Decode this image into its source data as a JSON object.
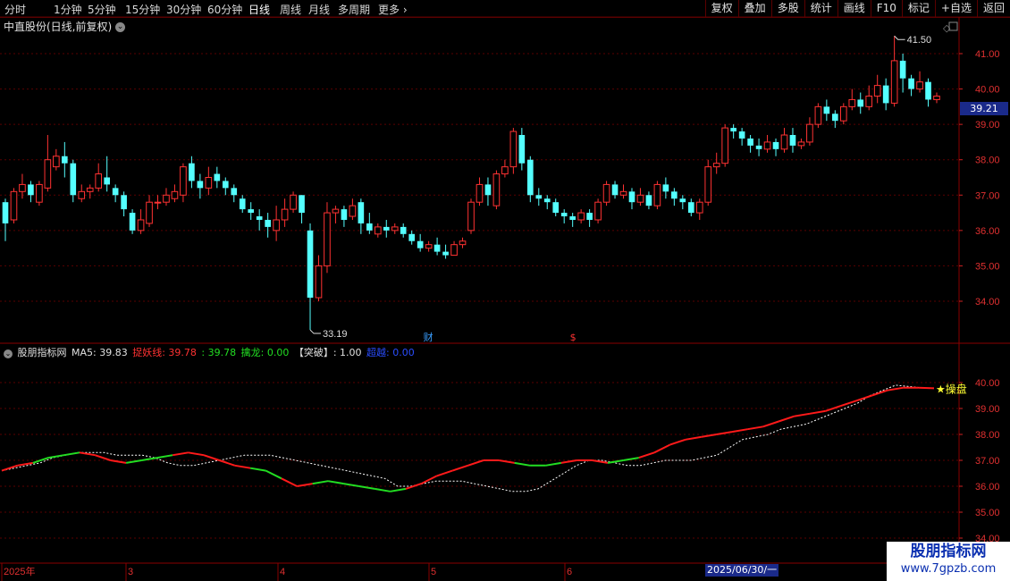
{
  "toolbar": {
    "timeframes": [
      "分时",
      "1分钟",
      "5分钟",
      "15分钟",
      "30分钟",
      "60分钟",
      "日线",
      "周线",
      "月线",
      "多周期",
      "更多"
    ],
    "active": "日线",
    "right_buttons": [
      "复权",
      "叠加",
      "多股",
      "统计",
      "画线",
      "F10",
      "标记",
      "+自选",
      "返回"
    ]
  },
  "stock": {
    "title": "中直股份(日线,前复权)",
    "current_price": "39.21",
    "high_label": "41.50",
    "low_label": "33.19",
    "event_cai": "财",
    "event_s": "$"
  },
  "price_axis": {
    "ticks": [
      "41.00",
      "40.00",
      "39.00",
      "38.00",
      "37.00",
      "36.00",
      "35.00",
      "34.00"
    ]
  },
  "indicator": {
    "name": "股朋指标网",
    "ma5_label": "MA5: 39.83",
    "zhuoyao_label": "捉妖线: 39.78",
    "zhuoyao_value": ": 39.78",
    "qinlong_label": "擒龙: 0.00",
    "tupo_label": "【突破】: 1.00",
    "chaoyue_label": "超越: 0.00",
    "marker_label": "★操盘",
    "ticks": [
      "40.00",
      "39.00",
      "38.00",
      "37.00",
      "36.00",
      "35.00",
      "34.00"
    ]
  },
  "time_axis": {
    "labels": [
      "2025年",
      "3",
      "4",
      "5",
      "6"
    ],
    "date_tag": "2025/06/30/一"
  },
  "watermark": {
    "line1": "股朋指标网",
    "line2": "www.7gpzb.com"
  },
  "colors": {
    "up": "#ff3232",
    "down": "#54ffff",
    "grid": "#5a0000",
    "bull_line": "#ff1a1a",
    "bear_line": "#22dd22",
    "ma_line": "#ffffff"
  },
  "chart_data": {
    "type": "candlestick",
    "candles": [
      [
        36.8,
        36.2,
        36.9,
        35.7
      ],
      [
        36.3,
        37.1,
        37.2,
        36.2
      ],
      [
        37.1,
        37.3,
        37.6,
        36.9
      ],
      [
        37.3,
        37.0,
        37.4,
        36.8
      ],
      [
        36.8,
        37.3,
        37.4,
        36.7
      ],
      [
        37.2,
        38.0,
        38.7,
        37.1
      ],
      [
        37.8,
        38.1,
        38.3,
        37.7
      ],
      [
        38.1,
        37.9,
        38.5,
        37.5
      ],
      [
        37.9,
        37.0,
        38.0,
        36.8
      ],
      [
        36.9,
        37.1,
        37.3,
        36.8
      ],
      [
        37.1,
        37.2,
        37.3,
        36.9
      ],
      [
        37.2,
        37.6,
        37.9,
        37.1
      ],
      [
        37.5,
        37.3,
        38.1,
        37.1
      ],
      [
        37.2,
        37.0,
        37.3,
        36.8
      ],
      [
        37.0,
        36.6,
        37.1,
        36.4
      ],
      [
        36.5,
        36.0,
        36.6,
        35.9
      ],
      [
        36.0,
        36.3,
        36.6,
        35.9
      ],
      [
        36.2,
        36.8,
        37.0,
        36.1
      ],
      [
        36.8,
        36.8,
        37.0,
        36.6
      ],
      [
        36.8,
        37.0,
        37.2,
        36.7
      ],
      [
        36.9,
        37.1,
        37.3,
        36.8
      ],
      [
        37.0,
        37.8,
        37.9,
        36.8
      ],
      [
        37.9,
        37.4,
        38.1,
        37.2
      ],
      [
        37.4,
        37.2,
        37.6,
        36.9
      ],
      [
        37.2,
        37.5,
        37.8,
        37.0
      ],
      [
        37.6,
        37.4,
        37.8,
        37.2
      ],
      [
        37.4,
        37.2,
        37.5,
        37.0
      ],
      [
        37.2,
        37.0,
        37.3,
        36.8
      ],
      [
        36.9,
        36.6,
        37.0,
        36.5
      ],
      [
        36.6,
        36.5,
        36.8,
        36.3
      ],
      [
        36.4,
        36.3,
        36.6,
        36.0
      ],
      [
        36.3,
        36.1,
        36.5,
        35.8
      ],
      [
        36.0,
        36.3,
        36.7,
        35.7
      ],
      [
        36.3,
        36.6,
        36.9,
        36.1
      ],
      [
        36.6,
        37.0,
        37.1,
        36.5
      ],
      [
        37.0,
        36.5,
        37.0,
        36.2
      ],
      [
        36.0,
        34.1,
        36.2,
        33.19
      ],
      [
        34.1,
        35.0,
        35.3,
        34.0
      ],
      [
        35.0,
        36.5,
        36.8,
        34.8
      ],
      [
        36.5,
        36.6,
        36.7,
        36.2
      ],
      [
        36.6,
        36.3,
        36.7,
        36.1
      ],
      [
        36.4,
        36.7,
        36.9,
        36.3
      ],
      [
        36.8,
        36.2,
        36.9,
        35.9
      ],
      [
        36.2,
        36.0,
        36.5,
        35.9
      ],
      [
        35.9,
        36.1,
        36.2,
        35.8
      ],
      [
        36.1,
        36.0,
        36.3,
        35.8
      ],
      [
        36.0,
        36.1,
        36.2,
        35.9
      ],
      [
        36.1,
        35.9,
        36.2,
        35.8
      ],
      [
        35.9,
        35.7,
        36.0,
        35.6
      ],
      [
        35.7,
        35.5,
        35.9,
        35.4
      ],
      [
        35.5,
        35.6,
        35.7,
        35.4
      ],
      [
        35.6,
        35.4,
        35.8,
        35.3
      ],
      [
        35.4,
        35.3,
        35.6,
        35.2
      ],
      [
        35.3,
        35.6,
        35.7,
        35.3
      ],
      [
        35.6,
        35.7,
        35.8,
        35.5
      ],
      [
        36.0,
        36.8,
        36.9,
        35.9
      ],
      [
        36.8,
        37.3,
        37.5,
        36.7
      ],
      [
        37.3,
        37.0,
        37.5,
        36.7
      ],
      [
        36.7,
        37.6,
        37.7,
        36.6
      ],
      [
        37.6,
        37.8,
        38.0,
        37.5
      ],
      [
        37.8,
        38.8,
        38.9,
        37.6
      ],
      [
        38.7,
        37.9,
        38.9,
        37.7
      ],
      [
        38.0,
        37.0,
        38.1,
        36.8
      ],
      [
        37.0,
        36.9,
        37.2,
        36.7
      ],
      [
        36.9,
        36.8,
        37.0,
        36.6
      ],
      [
        36.8,
        36.5,
        36.9,
        36.4
      ],
      [
        36.5,
        36.4,
        36.6,
        36.2
      ],
      [
        36.4,
        36.3,
        36.5,
        36.1
      ],
      [
        36.3,
        36.5,
        36.6,
        36.2
      ],
      [
        36.5,
        36.3,
        36.6,
        36.1
      ],
      [
        36.3,
        36.8,
        36.9,
        36.2
      ],
      [
        36.8,
        37.3,
        37.4,
        36.7
      ],
      [
        37.3,
        37.0,
        37.4,
        36.9
      ],
      [
        37.0,
        37.1,
        37.3,
        36.9
      ],
      [
        37.1,
        36.8,
        37.2,
        36.6
      ],
      [
        36.8,
        37.0,
        37.2,
        36.7
      ],
      [
        37.0,
        36.7,
        37.1,
        36.6
      ],
      [
        36.7,
        37.3,
        37.4,
        36.6
      ],
      [
        37.3,
        37.1,
        37.5,
        36.9
      ],
      [
        37.1,
        36.9,
        37.2,
        36.7
      ],
      [
        36.9,
        36.8,
        37.0,
        36.6
      ],
      [
        36.8,
        36.5,
        36.9,
        36.4
      ],
      [
        36.5,
        36.8,
        36.9,
        36.3
      ],
      [
        36.8,
        37.8,
        38.0,
        36.7
      ],
      [
        37.8,
        37.9,
        38.2,
        37.6
      ],
      [
        37.9,
        38.9,
        39.0,
        37.8
      ],
      [
        38.9,
        38.8,
        39.0,
        38.6
      ],
      [
        38.8,
        38.6,
        38.9,
        38.4
      ],
      [
        38.6,
        38.4,
        38.7,
        38.2
      ],
      [
        38.4,
        38.3,
        38.6,
        38.1
      ],
      [
        38.3,
        38.5,
        38.7,
        38.2
      ],
      [
        38.5,
        38.3,
        38.6,
        38.1
      ],
      [
        38.3,
        38.7,
        38.9,
        38.2
      ],
      [
        38.7,
        38.4,
        38.9,
        38.2
      ],
      [
        38.4,
        38.5,
        38.6,
        38.3
      ],
      [
        38.5,
        39.0,
        39.2,
        38.4
      ],
      [
        39.0,
        39.5,
        39.6,
        38.9
      ],
      [
        39.5,
        39.3,
        39.7,
        39.1
      ],
      [
        39.3,
        39.1,
        39.4,
        38.9
      ],
      [
        39.1,
        39.5,
        39.6,
        39.0
      ],
      [
        39.5,
        39.7,
        40.0,
        39.4
      ],
      [
        39.7,
        39.5,
        39.9,
        39.3
      ],
      [
        39.5,
        39.8,
        40.1,
        39.4
      ],
      [
        39.8,
        40.1,
        40.4,
        39.6
      ],
      [
        40.1,
        39.6,
        40.3,
        39.4
      ],
      [
        39.6,
        40.8,
        41.5,
        39.5
      ],
      [
        40.8,
        40.3,
        41.0,
        39.9
      ],
      [
        40.3,
        40.0,
        40.4,
        39.8
      ],
      [
        40.0,
        40.2,
        40.5,
        39.9
      ],
      [
        40.2,
        39.7,
        40.3,
        39.5
      ],
      [
        39.7,
        39.8,
        39.9,
        39.6
      ]
    ],
    "ma_line": [
      36.6,
      36.7,
      36.8,
      36.9,
      37.1,
      37.2,
      37.3,
      37.3,
      37.3,
      37.2,
      37.2,
      37.2,
      37.1,
      36.9,
      36.8,
      36.8,
      36.9,
      37.0,
      37.1,
      37.2,
      37.2,
      37.2,
      37.1,
      37.0,
      36.9,
      36.8,
      36.7,
      36.6,
      36.5,
      36.4,
      36.3,
      36.0,
      36.0,
      36.1,
      36.2,
      36.2,
      36.2,
      36.1,
      36.0,
      35.9,
      35.8,
      35.8,
      35.9,
      36.2,
      36.5,
      36.8,
      37.0,
      37.0,
      36.9,
      36.8,
      36.8,
      36.9,
      37.0,
      37.0,
      37.0,
      37.1,
      37.2,
      37.5,
      37.8,
      37.9,
      38.0,
      38.2,
      38.3,
      38.4,
      38.6,
      38.8,
      39.0,
      39.2,
      39.5,
      39.7,
      39.9,
      39.85,
      39.8,
      39.78
    ],
    "trend_line": [
      36.6,
      36.8,
      36.9,
      37.1,
      37.2,
      37.3,
      37.2,
      37.0,
      36.9,
      37.0,
      37.1,
      37.2,
      37.3,
      37.2,
      37.0,
      36.8,
      36.7,
      36.6,
      36.3,
      36.0,
      36.1,
      36.2,
      36.1,
      36.0,
      35.9,
      35.8,
      35.9,
      36.1,
      36.4,
      36.6,
      36.8,
      37.0,
      37.0,
      36.9,
      36.8,
      36.8,
      36.9,
      37.0,
      37.0,
      36.9,
      37.0,
      37.1,
      37.3,
      37.6,
      37.8,
      37.9,
      38.0,
      38.1,
      38.2,
      38.3,
      38.5,
      38.7,
      38.8,
      38.9,
      39.1,
      39.3,
      39.5,
      39.7,
      39.8,
      39.8,
      39.78
    ],
    "trend_color": [
      1,
      1,
      0,
      0,
      0,
      1,
      1,
      1,
      0,
      0,
      0,
      1,
      1,
      1,
      1,
      1,
      0,
      0,
      1,
      1,
      0,
      0,
      0,
      0,
      0,
      0,
      1,
      1,
      1,
      1,
      1,
      1,
      1,
      0,
      0,
      0,
      1,
      1,
      1,
      0,
      0,
      1,
      1,
      1,
      1,
      1,
      1,
      1,
      1,
      1,
      1,
      1,
      1,
      1,
      1,
      1,
      1,
      1,
      1,
      1,
      1
    ]
  }
}
